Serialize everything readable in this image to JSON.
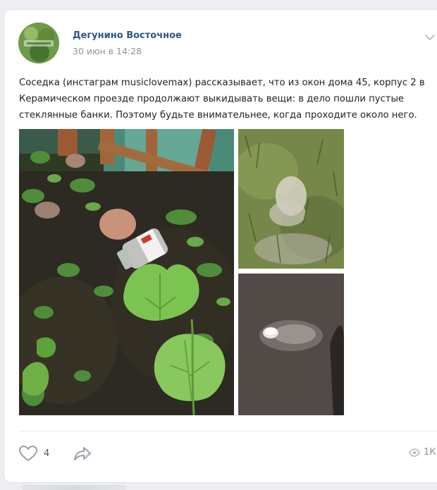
{
  "post": {
    "author": "Дегунино Восточное",
    "date": "30 июн в 14:28",
    "text": "Соседка (инстаграм musiclovemax) рассказывает, что из окон дома 45, корпус 2 в Керамическом проезде продолжают выкидывать вещи: в дело пошли пустые стеклянные банки. Поэтому будьте внимательнее, когда проходите около него.",
    "photos": [
      {
        "name": "photo-jar-in-garden"
      },
      {
        "name": "photo-powder-on-grass"
      },
      {
        "name": "photo-powder-on-asphalt"
      }
    ]
  },
  "footer": {
    "likes": "4",
    "views": "1К"
  },
  "icons": {
    "like": "heart-icon",
    "share": "share-arrow-icon",
    "views": "eye-icon",
    "menu": "chevron-down-icon"
  },
  "colors": {
    "link": "#2a5885",
    "secondary": "#939393",
    "background": "#eceef1"
  }
}
